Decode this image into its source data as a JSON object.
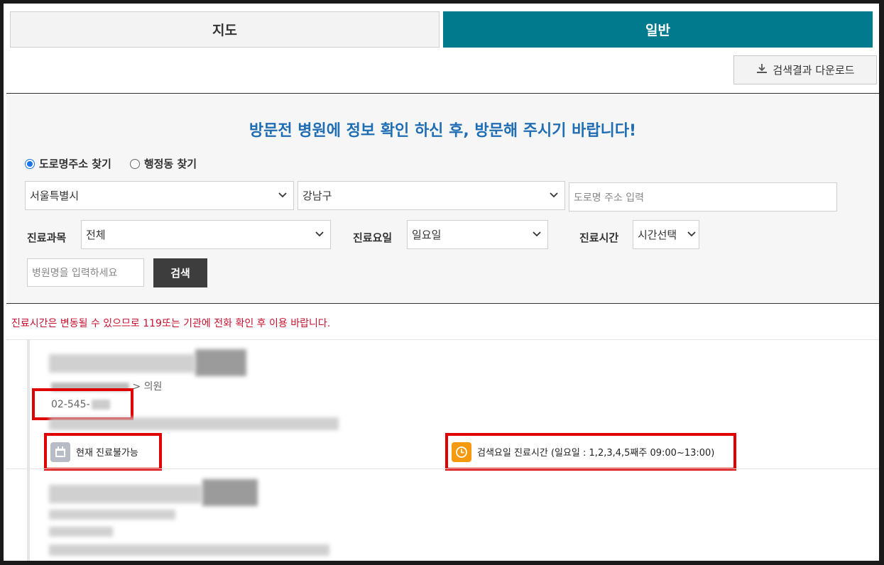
{
  "tabs": {
    "map": "지도",
    "general": "일반"
  },
  "download_button": "검색결과 다운로드",
  "notice_title": "방문전 병원에 정보 확인 하신 후, 방문해 주시기 바랍니다!",
  "search": {
    "radio_road": "도로명주소 찾기",
    "radio_admin": "행정동 찾기",
    "city": "서울특별시",
    "district": "강남구",
    "road_placeholder": "도로명 주소 입력",
    "dept_label": "진료과목",
    "dept_value": "전체",
    "day_label": "진료요일",
    "day_value": "일요일",
    "time_label": "진료시간",
    "time_value": "시간선택",
    "hospital_placeholder": "병원명을 입력하세요",
    "search_button": "검색"
  },
  "warning": "진료시간은 변동될 수 있으므로 119또는 기관에 전화 확인 후 이용 바랍니다.",
  "results": [
    {
      "category_prefix": "",
      "category_suffix": "> 의원",
      "phone": "02-545-",
      "status": "현재 진료불가능",
      "hours": "검색요일 진료시간 (일요일 : 1,2,3,4,5째주 09:00~13:00)"
    }
  ],
  "colors": {
    "accent": "#027a8e",
    "title_blue": "#1f6eb4",
    "warning_red": "#c8102e",
    "highlight_red": "#e00000",
    "clock_orange": "#f59a0c"
  },
  "icons": {
    "download": "download-icon",
    "calendar": "calendar-icon",
    "clock": "clock-icon",
    "chevron": "chevron-down-icon"
  }
}
